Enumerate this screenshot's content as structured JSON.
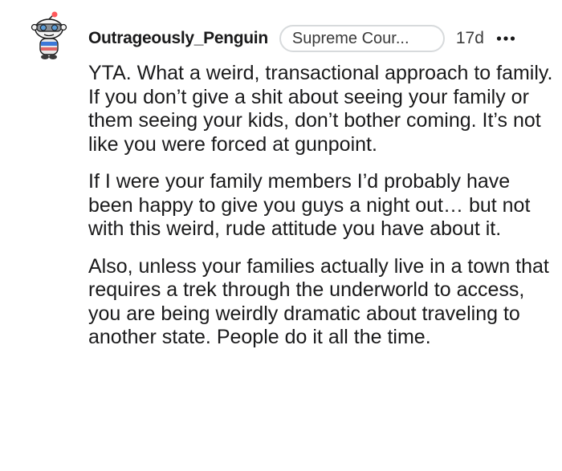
{
  "comment": {
    "username": "Outrageously_Penguin",
    "flair": "Supreme Cour...",
    "timestamp": "17d",
    "more_icon": "more-horizontal-icon",
    "avatar_icon": "snoo-avatar-icon",
    "paragraphs": [
      "YTA. What a weird, transactional approach to family. If you don’t give a shit about seeing your family or them seeing your kids, don’t bother coming. It’s not like you were forced at gunpoint.",
      "If I were your family members I’d probably have been happy to give you guys a night out… but not with this weird, rude attitude you have about it.",
      "Also, unless your families actually live in a town that requires a trek through the underworld to access, you are being weirdly dramatic about traveling to another state. People do it all the time."
    ]
  },
  "colors": {
    "text": "#1a1a1b",
    "meta": "#3a3a3a",
    "flair_border": "#d7dadc",
    "avatar_antenna": "#ff585b"
  }
}
